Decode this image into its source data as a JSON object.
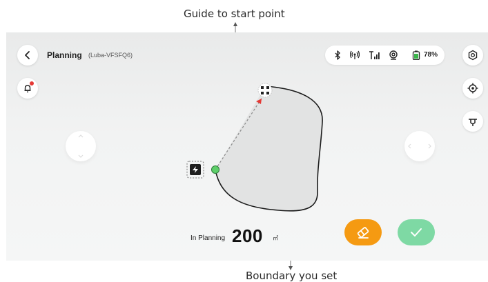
{
  "annotations": {
    "top": "Guide to start point",
    "bottom": "Boundary you set"
  },
  "header": {
    "title": "Planning",
    "subtitle": "(Luba-VFSFQ6)"
  },
  "status": {
    "icons": [
      "bluetooth-icon",
      "rtk-antenna-icon",
      "cellular-signal-icon",
      "wifi-target-icon",
      "battery-icon"
    ],
    "battery_text": "78%"
  },
  "planning": {
    "label": "In Planning",
    "area": "200",
    "unit": "㎡"
  },
  "colors": {
    "erase": "#f59a12",
    "confirm": "#7ed9a4",
    "start_point": "#5ecf6a",
    "notification_dot": "#e53935"
  }
}
